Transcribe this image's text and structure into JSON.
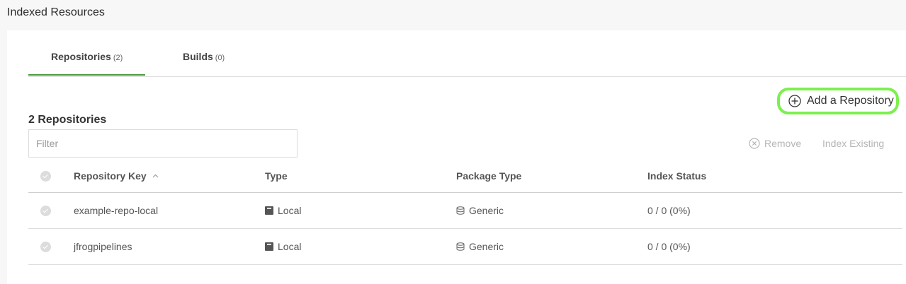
{
  "page": {
    "title": "Indexed Resources"
  },
  "tabs": [
    {
      "label": "Repositories",
      "count": "(2)"
    },
    {
      "label": "Builds",
      "count": "(0)"
    }
  ],
  "add_button": {
    "label": "Add a Repository"
  },
  "list": {
    "count_title": "2 Repositories",
    "filter_placeholder": "Filter",
    "actions": {
      "remove": "Remove",
      "index_existing": "Index Existing"
    }
  },
  "table": {
    "columns": [
      "Repository Key",
      "Type",
      "Package Type",
      "Index Status"
    ],
    "rows": [
      {
        "key": "example-repo-local",
        "type": "Local",
        "package_type": "Generic",
        "status": "0 / 0 (0%)"
      },
      {
        "key": "jfrogpipelines",
        "type": "Local",
        "package_type": "Generic",
        "status": "0 / 0 (0%)"
      }
    ]
  },
  "colors": {
    "accent": "#4a9a3e",
    "highlight": "#7cf04e"
  },
  "icons": {
    "add": "plus-circle-icon",
    "remove": "x-circle-icon",
    "sort": "sort-asc-icon",
    "local": "local-repo-icon",
    "generic": "generic-package-icon"
  }
}
